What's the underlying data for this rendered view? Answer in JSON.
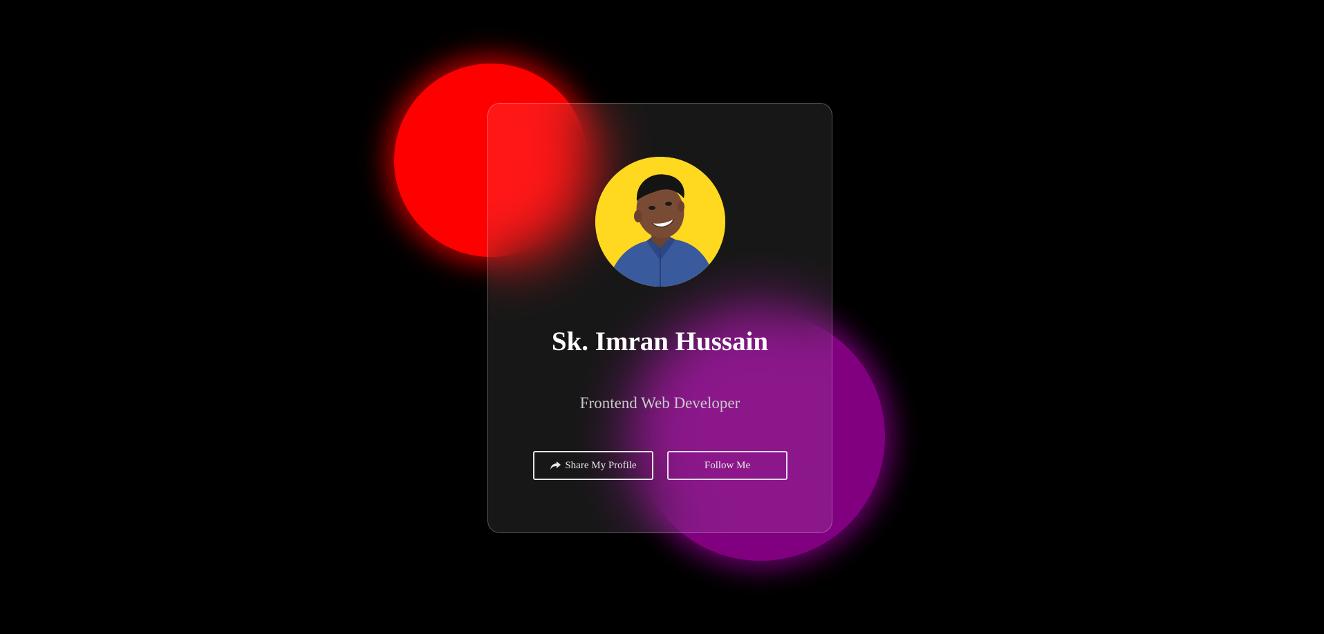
{
  "profile": {
    "name": "Sk. Imran Hussain",
    "role": "Frontend Web Developer",
    "avatar_alt": "Profile photo"
  },
  "buttons": {
    "share_label": "Share My Profile",
    "share_icon": "share-arrow-icon",
    "follow_label": "Follow Me"
  },
  "colors": {
    "background": "#000000",
    "blob_red": "#ff0000",
    "blob_purple": "#800080",
    "avatar_background": "#ffd820",
    "name_text": "#ffffff",
    "role_text": "#c9c9c9"
  }
}
